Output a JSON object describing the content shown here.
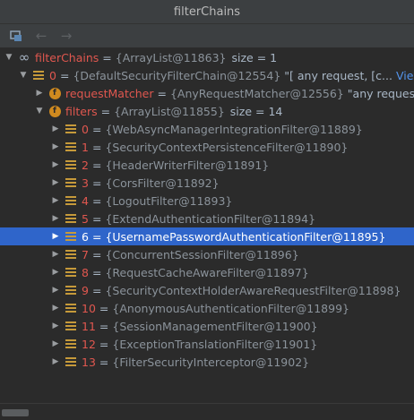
{
  "window": {
    "title": "filterChains"
  },
  "toolbar": {
    "icons": [
      "restore-layout-icon",
      "back-arrow-icon",
      "forward-arrow-icon"
    ]
  },
  "tree": {
    "root": {
      "name": "filterChains",
      "eq": "=",
      "value": "{ArrayList@11863}",
      "size": "size = 1"
    },
    "chain": {
      "name": "0",
      "eq": "=",
      "value": "{DefaultSecurityFilterChain@12554}",
      "extra": "\"[ any request, [c...",
      "link": "View"
    },
    "matcher": {
      "name": "requestMatcher",
      "eq": "=",
      "value": "{AnyRequestMatcher@12556}",
      "extra": "\"any request\""
    },
    "filters": {
      "name": "filters",
      "eq": "=",
      "value": "{ArrayList@11855}",
      "size": "size = 14"
    },
    "items": [
      {
        "name": "0",
        "eq": "=",
        "value": "{WebAsyncManagerIntegrationFilter@11889}"
      },
      {
        "name": "1",
        "eq": "=",
        "value": "{SecurityContextPersistenceFilter@11890}"
      },
      {
        "name": "2",
        "eq": "=",
        "value": "{HeaderWriterFilter@11891}"
      },
      {
        "name": "3",
        "eq": "=",
        "value": "{CorsFilter@11892}"
      },
      {
        "name": "4",
        "eq": "=",
        "value": "{LogoutFilter@11893}"
      },
      {
        "name": "5",
        "eq": "=",
        "value": "{ExtendAuthenticationFilter@11894}"
      },
      {
        "name": "6",
        "eq": "=",
        "value": "{UsernamePasswordAuthenticationFilter@11895}"
      },
      {
        "name": "7",
        "eq": "=",
        "value": "{ConcurrentSessionFilter@11896}"
      },
      {
        "name": "8",
        "eq": "=",
        "value": "{RequestCacheAwareFilter@11897}"
      },
      {
        "name": "9",
        "eq": "=",
        "value": "{SecurityContextHolderAwareRequestFilter@11898}"
      },
      {
        "name": "10",
        "eq": "=",
        "value": "{AnonymousAuthenticationFilter@11899}"
      },
      {
        "name": "11",
        "eq": "=",
        "value": "{SessionManagementFilter@11900}"
      },
      {
        "name": "12",
        "eq": "=",
        "value": "{ExceptionTranslationFilter@11901}"
      },
      {
        "name": "13",
        "eq": "=",
        "value": "{FilterSecurityInterceptor@11902}"
      }
    ]
  },
  "colors": {
    "selected_row": "#2f65ca",
    "field_icon": "#d08a1f",
    "list_icon": "#c69a3a",
    "link": "#5394ec"
  }
}
